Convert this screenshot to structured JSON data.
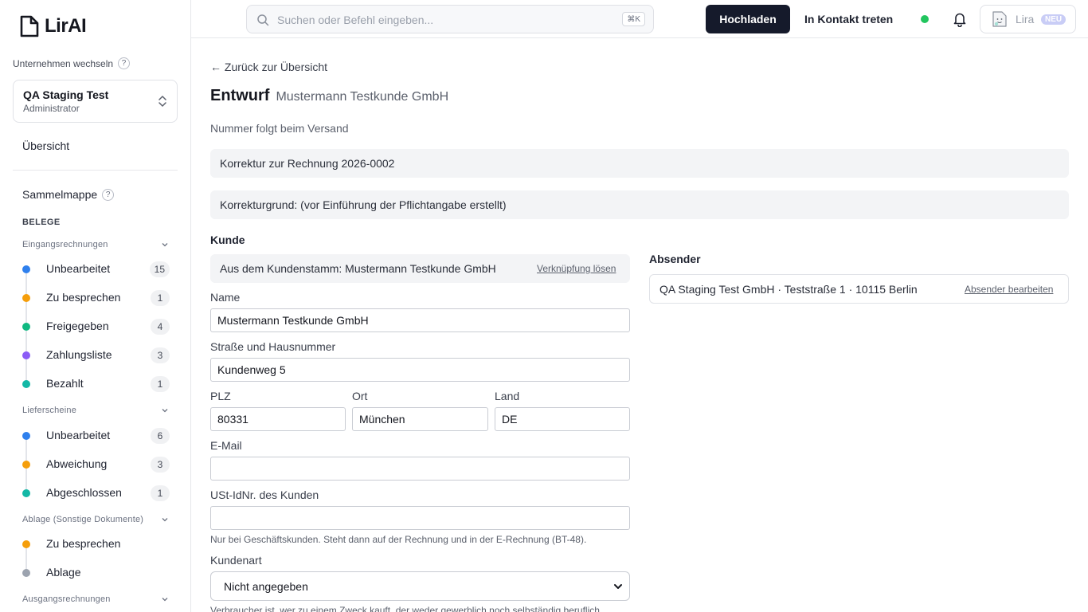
{
  "brand": {
    "name": "LirAI"
  },
  "sidebar": {
    "company_switch_label": "Unternehmen wechseln",
    "help_mark": "?",
    "company": {
      "name": "QA Staging Test",
      "role": "Administrator"
    },
    "overview": "Übersicht",
    "sammelmappe": "Sammelmappe",
    "section_title": "BELEGE",
    "groups": [
      {
        "title": "Eingangsrechnungen",
        "items": [
          {
            "label": "Unbearbeitet",
            "count": "15",
            "color": "#2f80ed"
          },
          {
            "label": "Zu besprechen",
            "count": "1",
            "color": "#f59e0b"
          },
          {
            "label": "Freigegeben",
            "count": "4",
            "color": "#10b981"
          },
          {
            "label": "Zahlungsliste",
            "count": "3",
            "color": "#8b5cf6"
          },
          {
            "label": "Bezahlt",
            "count": "1",
            "color": "#14b8a6"
          }
        ]
      },
      {
        "title": "Lieferscheine",
        "items": [
          {
            "label": "Unbearbeitet",
            "count": "6",
            "color": "#2f80ed"
          },
          {
            "label": "Abweichung",
            "count": "3",
            "color": "#f59e0b"
          },
          {
            "label": "Abgeschlossen",
            "count": "1",
            "color": "#14b8a6"
          }
        ]
      },
      {
        "title": "Ablage (Sonstige Dokumente)",
        "items": [
          {
            "label": "Zu besprechen",
            "color": "#f59e0b"
          },
          {
            "label": "Ablage",
            "color": "#9ca3af"
          }
        ]
      },
      {
        "title": "Ausgangsrechnungen",
        "items": []
      }
    ]
  },
  "header": {
    "search_placeholder": "Suchen oder Befehl eingeben...",
    "shortcut": "⌘K",
    "upload_label": "Hochladen",
    "contact_label": "In Kontakt treten",
    "status_color": "#22c55e",
    "assistant_label": "Lira",
    "new_badge": "NEU"
  },
  "main": {
    "back_link": "← Zurück zur Übersicht",
    "title": "Entwurf",
    "subtitle": "Mustermann Testkunde GmbH",
    "number_note": "Nummer folgt beim Versand",
    "correction_ref": "Korrektur zur Rechnung 2026-0002",
    "correction_reason": "Korrekturgrund: (vor Einführung der Pflichtangabe erstellt)",
    "customer_section": "Kunde",
    "customer_link_text": "Aus dem Kundenstamm: Mustermann Testkunde GmbH",
    "unlink_label": "Verknüpfung lösen",
    "fields": {
      "name_label": "Name",
      "name_value": "Mustermann Testkunde GmbH",
      "street_label": "Straße und Hausnummer",
      "street_value": "Kundenweg 5",
      "zip_label": "PLZ",
      "zip_value": "80331",
      "city_label": "Ort",
      "city_value": "München",
      "country_label": "Land",
      "country_value": "DE",
      "email_label": "E-Mail",
      "email_value": "",
      "vat_label": "USt-IdNr. des Kunden",
      "vat_value": "",
      "vat_hint": "Nur bei Geschäftskunden. Steht dann auf der Rechnung und in der E-Rechnung (BT-48).",
      "customer_type_label": "Kundenart",
      "customer_type_value": "Nicht angegeben",
      "customer_type_hint": "Verbraucher ist, wer zu einem Zweck kauft, der weder gewerblich noch selbständig beruflich"
    },
    "sender_section": "Absender",
    "sender_text": "QA Staging Test GmbH · Teststraße 1 · 10115 Berlin",
    "sender_edit": "Absender bearbeiten"
  }
}
